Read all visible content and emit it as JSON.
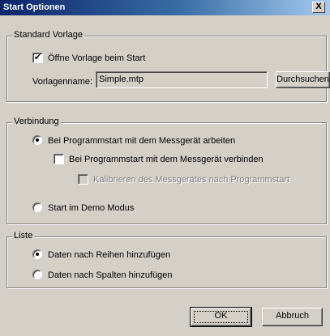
{
  "window": {
    "title": "Start Optionen",
    "close_label": "X"
  },
  "standard_vorlage": {
    "group_label": "Standard Vorlage",
    "open_template_checkbox": {
      "label": "Öffne Vorlage beim Start",
      "checked": true,
      "mark": "✔"
    },
    "template_name_label": "Vorlagenname:",
    "template_name_value": "Simple.mtp",
    "browse_button": "Durchsuchen"
  },
  "verbindung": {
    "group_label": "Verbindung",
    "radio_work_with_device": {
      "label": "Bei Programmstart mit dem Messgerät arbeiten",
      "selected": true
    },
    "checkbox_connect": {
      "label": "Bei Programmstart mit dem Messgerät verbinden",
      "checked": false
    },
    "checkbox_calibrate": {
      "label": "Kalibrieren des Messgerätes nach Programmstart",
      "checked": false,
      "disabled": true
    },
    "radio_demo": {
      "label": "Start im Demo Modus",
      "selected": false
    }
  },
  "liste": {
    "group_label": "Liste",
    "radio_rows": {
      "label": "Daten nach Reihen hinzufügen",
      "selected": true
    },
    "radio_columns": {
      "label": "Daten nach Spalten hinzufügen",
      "selected": false
    }
  },
  "buttons": {
    "ok": "OK",
    "cancel": "Abbruch"
  }
}
